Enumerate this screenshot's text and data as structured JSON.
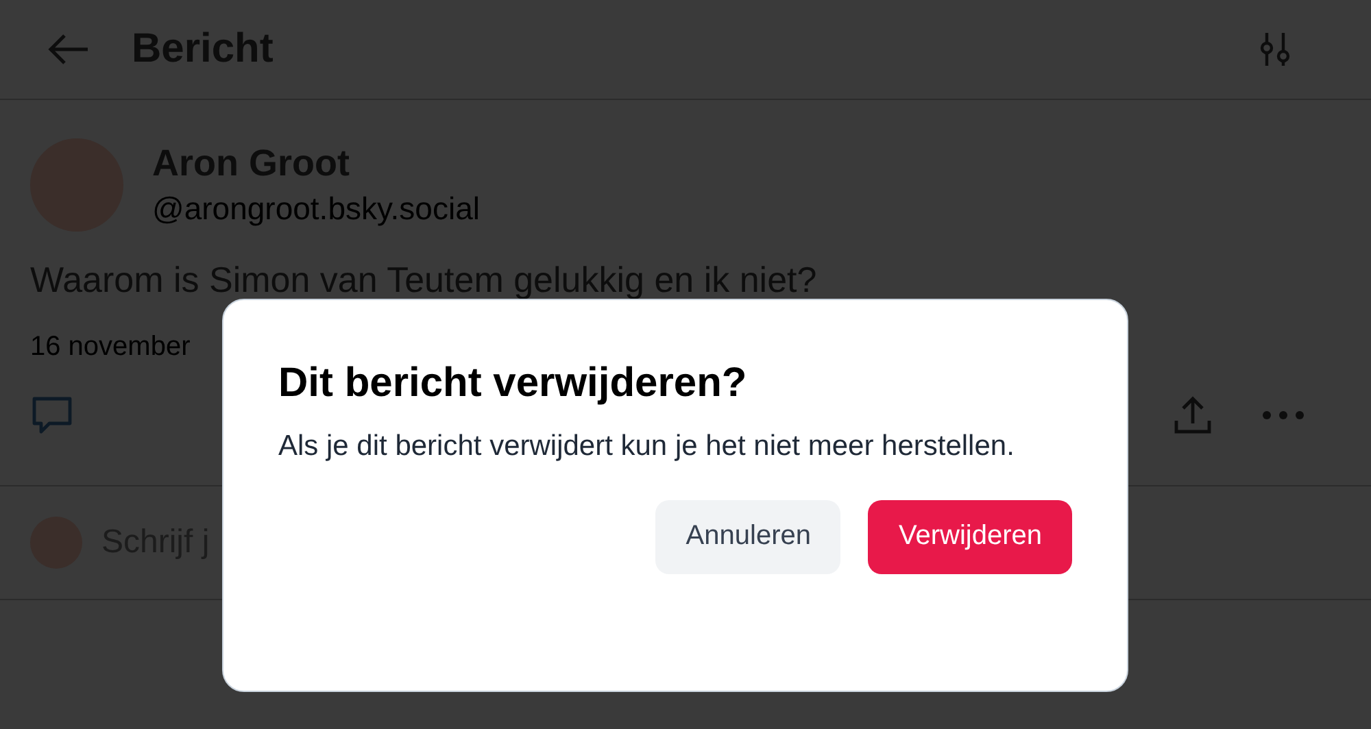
{
  "header": {
    "title": "Bericht"
  },
  "post": {
    "author": "Aron Groot",
    "handle": "@arongroot.bsky.social",
    "text": "Waarom is Simon van Teutem gelukkig en ik niet?",
    "date": "16 november"
  },
  "reply": {
    "placeholder": "Schrijf j"
  },
  "dialog": {
    "title": "Dit bericht verwijderen?",
    "message": "Als je dit bericht verwijdert kun je het niet meer herstellen.",
    "buttons": [
      {
        "label": "Annuleren",
        "kind": "secondary"
      },
      {
        "label": "Verwijderen",
        "kind": "danger"
      }
    ]
  }
}
